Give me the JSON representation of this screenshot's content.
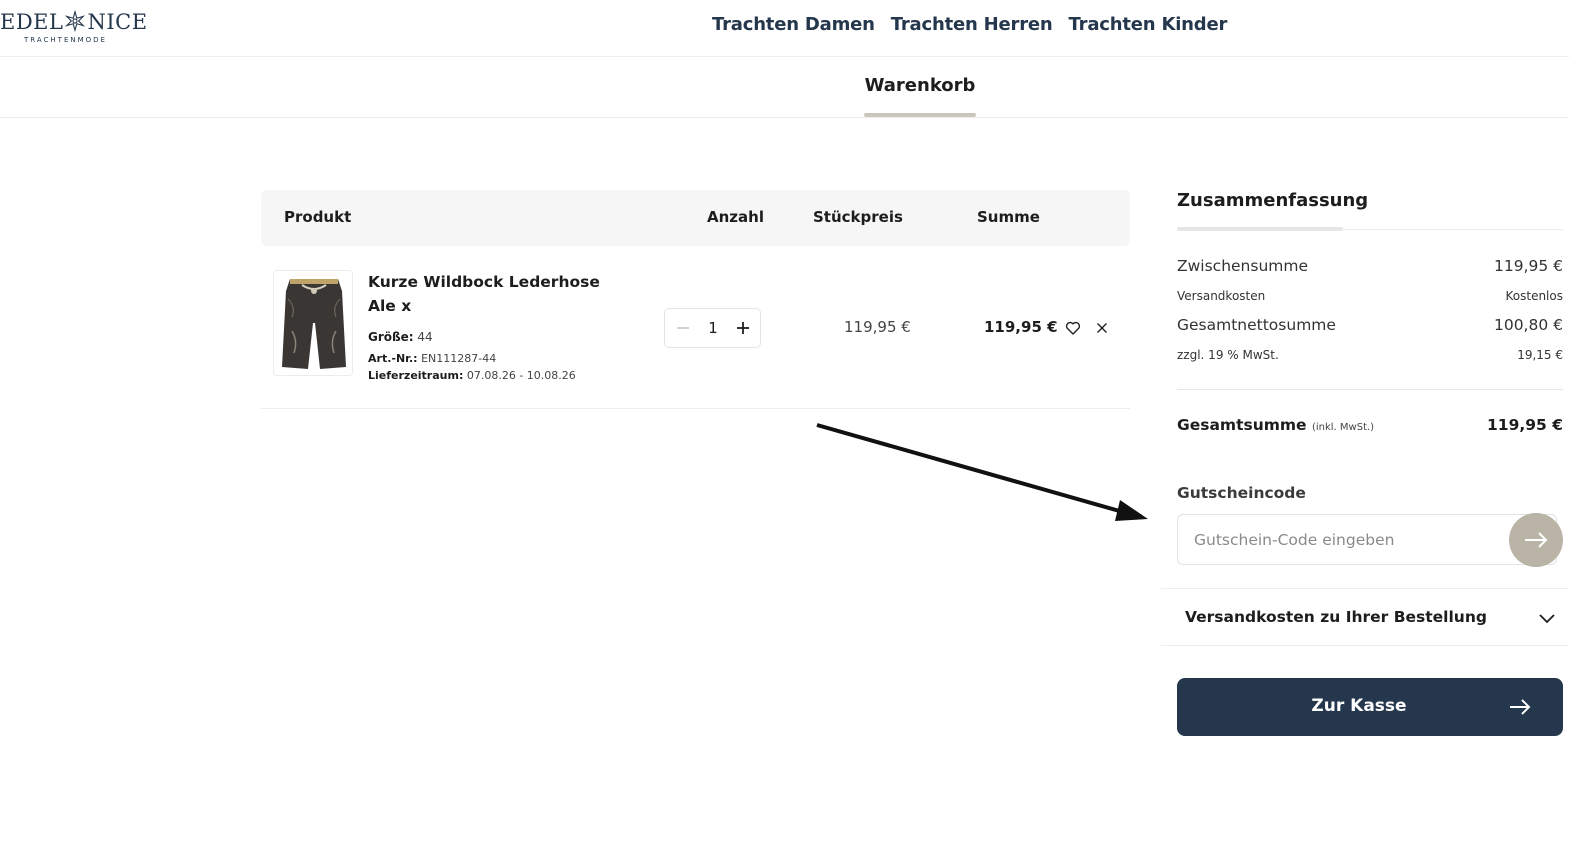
{
  "brand": {
    "name_left": "EDEL",
    "name_right": "NICE",
    "tagline": "TRACHTENMODE",
    "color": "#25374c"
  },
  "nav": {
    "items": [
      "Trachten Damen",
      "Trachten Herren",
      "Trachten Kinder"
    ]
  },
  "tabs": {
    "active": "Warenkorb"
  },
  "cart": {
    "columns": {
      "product": "Produkt",
      "quantity": "Anzahl",
      "unit_price": "Stückpreis",
      "sum": "Summe"
    },
    "items": [
      {
        "name": "Kurze Wildbock Lederhose Ale x",
        "size_label": "Größe:",
        "size": "44",
        "art_label": "Art.-Nr.:",
        "art_no": "EN111287-44",
        "delivery_label": "Lieferzeitraum:",
        "delivery": "07.08.26 - 10.08.26",
        "quantity": "1",
        "unit_price": "119,95 €",
        "sum": "119,95 €",
        "image_icon": "lederhose-image"
      }
    ]
  },
  "summary": {
    "title": "Zusammenfassung",
    "subtotal_label": "Zwischensumme",
    "subtotal": "119,95 €",
    "shipping_label": "Versandkosten",
    "shipping": "Kostenlos",
    "net_label": "Gesamtnettosumme",
    "net": "100,80 €",
    "vat_label": "zzgl. 19 % MwSt.",
    "vat": "19,15 €",
    "total_label": "Gesamtsumme",
    "total_note": "(inkl. MwSt.)",
    "total": "119,95 €",
    "coupon_label": "Gutscheincode",
    "coupon_placeholder": "Gutschein-Code eingeben",
    "shipping_info_label": "Versandkosten zu Ihrer Bestellung",
    "checkout_label": "Zur Kasse"
  },
  "colors": {
    "primary": "#25374c",
    "accent": "#b9b4a6",
    "tab_underline": "#c9c6bd"
  }
}
